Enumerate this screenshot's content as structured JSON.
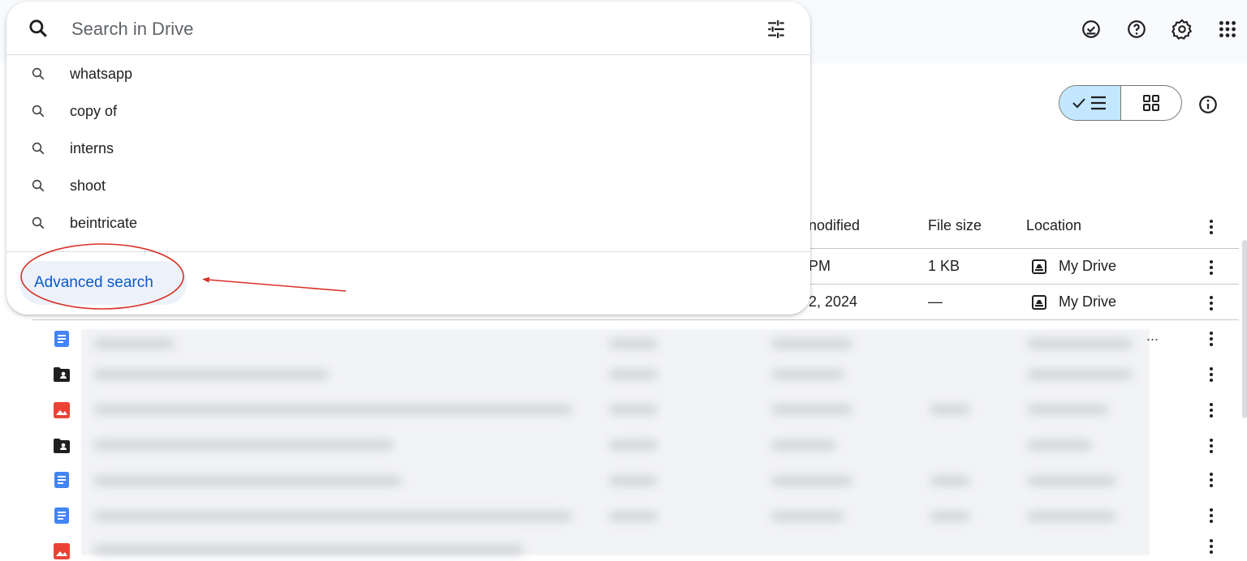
{
  "search": {
    "placeholder": "Search in Drive",
    "suggestions": [
      "whatsapp",
      "copy of",
      "interns",
      "shoot",
      "beintricate"
    ],
    "advanced_label": "Advanced search"
  },
  "table": {
    "headers": {
      "modified": "nodified",
      "file_size": "File size",
      "location": "Location"
    },
    "rows": [
      {
        "modified": "PM",
        "size": "1 KB",
        "location": "My Drive"
      },
      {
        "modified": "2, 2024",
        "size": "—",
        "location": "My Drive"
      }
    ],
    "truncated_location": "..."
  },
  "icons": {
    "top": [
      "ready-offline-icon",
      "help-icon",
      "settings-icon",
      "apps-grid-icon"
    ],
    "file_types": [
      "doc-icon",
      "shared-folder-icon",
      "image-icon",
      "shared-folder-icon",
      "doc-icon",
      "doc-icon",
      "image-icon"
    ]
  },
  "colors": {
    "accent_blue": "#0b57d0",
    "toggle_active": "#c2e7ff",
    "annotation_red": "#d93025",
    "doc_blue": "#4285f4",
    "image_red": "#ea4335"
  }
}
